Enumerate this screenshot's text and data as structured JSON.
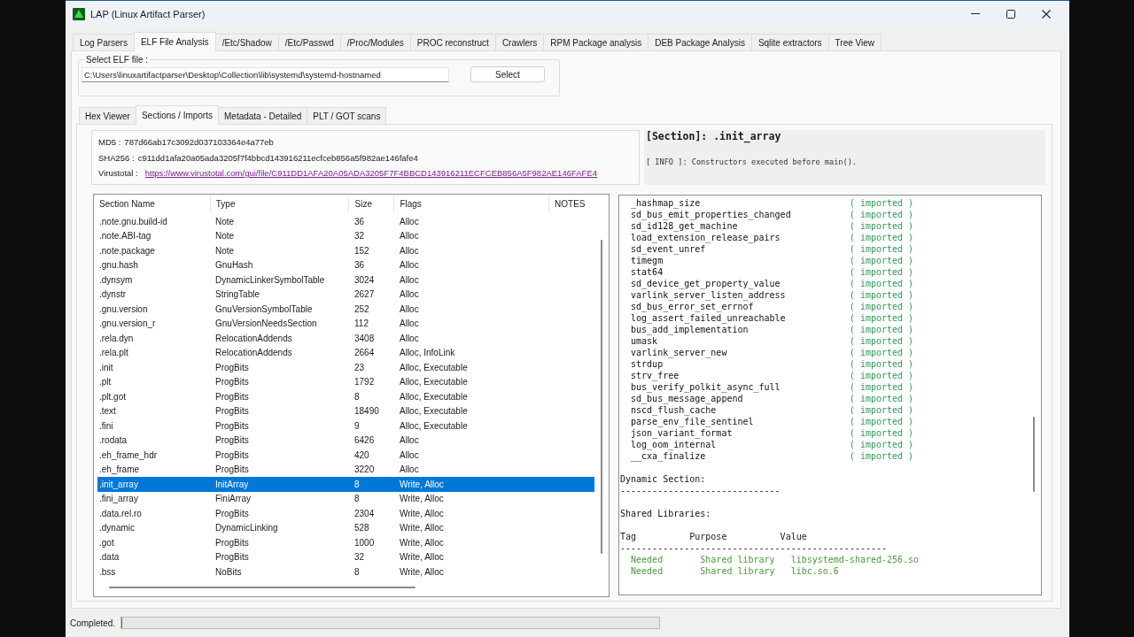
{
  "window": {
    "title": "LAP (Linux Artifact Parser)"
  },
  "tabs": [
    {
      "label": "Log Parsers",
      "selected": false
    },
    {
      "label": "ELF File Analysis",
      "selected": true
    },
    {
      "label": "/Etc/Shadow",
      "selected": false
    },
    {
      "label": "/Etc/Passwd",
      "selected": false
    },
    {
      "label": "/Proc/Modules",
      "selected": false
    },
    {
      "label": "PROC reconstruct",
      "selected": false
    },
    {
      "label": "Crawlers",
      "selected": false
    },
    {
      "label": "RPM Package analysis",
      "selected": false
    },
    {
      "label": "DEB Package Analysis",
      "selected": false
    },
    {
      "label": "Sqlite extractors",
      "selected": false
    },
    {
      "label": "Tree View",
      "selected": false
    }
  ],
  "elf_file": {
    "label": "Select ELF file :",
    "value": "C:\\Users\\linuxartifactparser\\Desktop\\Collection\\lib\\systemd\\systemd-hostnamed",
    "button": "Select"
  },
  "sub_tabs": [
    {
      "label": "Hex Viewer",
      "selected": false
    },
    {
      "label": "Sections / Imports",
      "selected": true
    },
    {
      "label": "Metadata - Detailed",
      "selected": false
    },
    {
      "label": "PLT / GOT scans",
      "selected": false
    }
  ],
  "hashes": [
    {
      "kind": "text",
      "label": "MD5 :",
      "value": "787d66ab17c3092d037103364e4a77eb"
    },
    {
      "kind": "text",
      "label": "SHA256 :",
      "value": "c911dd1afa20a05ada3205f7f4bbcd143916211ecfceb856a5f982ae146fafe4"
    },
    {
      "kind": "link",
      "label": "Virustotal :",
      "value": "https://www.virustotal.com/gui/file/C911DD1AFA20A05ADA3205F7F4BBCD143916211ECFCEB856A5F982AE146FAFE4"
    }
  ],
  "section_info": {
    "title": "[Section]: .init_array",
    "info": "[ INFO ]: Constructors executed before main()."
  },
  "sections_table": {
    "columns": [
      "Section Name",
      "Type",
      "Size",
      "Flags",
      "NOTES"
    ],
    "rows": [
      {
        "cells": [
          ".note.gnu.build-id",
          "Note",
          "36",
          "Alloc"
        ],
        "selected": false
      },
      {
        "cells": [
          ".note.ABI-tag",
          "Note",
          "32",
          "Alloc"
        ],
        "selected": false
      },
      {
        "cells": [
          ".note.package",
          "Note",
          "152",
          "Alloc"
        ],
        "selected": false
      },
      {
        "cells": [
          ".gnu.hash",
          "GnuHash",
          "36",
          "Alloc"
        ],
        "selected": false
      },
      {
        "cells": [
          ".dynsym",
          "DynamicLinkerSymbolTable",
          "3024",
          "Alloc"
        ],
        "selected": false
      },
      {
        "cells": [
          ".dynstr",
          "StringTable",
          "2627",
          "Alloc"
        ],
        "selected": false
      },
      {
        "cells": [
          ".gnu.version",
          "GnuVersionSymbolTable",
          "252",
          "Alloc"
        ],
        "selected": false
      },
      {
        "cells": [
          ".gnu.version_r",
          "GnuVersionNeedsSection",
          "112",
          "Alloc"
        ],
        "selected": false
      },
      {
        "cells": [
          ".rela.dyn",
          "RelocationAddends",
          "3408",
          "Alloc"
        ],
        "selected": false
      },
      {
        "cells": [
          ".rela.plt",
          "RelocationAddends",
          "2664",
          "Alloc, InfoLink"
        ],
        "selected": false
      },
      {
        "cells": [
          ".init",
          "ProgBits",
          "23",
          "Alloc, Executable"
        ],
        "selected": false
      },
      {
        "cells": [
          ".plt",
          "ProgBits",
          "1792",
          "Alloc, Executable"
        ],
        "selected": false
      },
      {
        "cells": [
          ".plt.got",
          "ProgBits",
          "8",
          "Alloc, Executable"
        ],
        "selected": false
      },
      {
        "cells": [
          ".text",
          "ProgBits",
          "18490",
          "Alloc, Executable"
        ],
        "selected": false
      },
      {
        "cells": [
          ".fini",
          "ProgBits",
          "9",
          "Alloc, Executable"
        ],
        "selected": false
      },
      {
        "cells": [
          ".rodata",
          "ProgBits",
          "6426",
          "Alloc"
        ],
        "selected": false
      },
      {
        "cells": [
          ".eh_frame_hdr",
          "ProgBits",
          "420",
          "Alloc"
        ],
        "selected": false
      },
      {
        "cells": [
          ".eh_frame",
          "ProgBits",
          "3220",
          "Alloc"
        ],
        "selected": false
      },
      {
        "cells": [
          ".init_array",
          "InitArray",
          "8",
          "Write, Alloc"
        ],
        "selected": true
      },
      {
        "cells": [
          ".fini_array",
          "FiniArray",
          "8",
          "Write, Alloc"
        ],
        "selected": false
      },
      {
        "cells": [
          ".data.rel.ro",
          "ProgBits",
          "2304",
          "Write, Alloc"
        ],
        "selected": false
      },
      {
        "cells": [
          ".dynamic",
          "DynamicLinking",
          "528",
          "Write, Alloc"
        ],
        "selected": false
      },
      {
        "cells": [
          ".got",
          "ProgBits",
          "1000",
          "Write, Alloc"
        ],
        "selected": false
      },
      {
        "cells": [
          ".data",
          "ProgBits",
          "32",
          "Write, Alloc"
        ],
        "selected": false
      },
      {
        "cells": [
          ".bss",
          "NoBits",
          "8",
          "Write, Alloc"
        ],
        "selected": false
      }
    ]
  },
  "output": {
    "lines": [
      {
        "kind": "import",
        "name": "_hashmap_size",
        "status": "( imported )"
      },
      {
        "kind": "import",
        "name": "sd_bus_emit_properties_changed",
        "status": "( imported )"
      },
      {
        "kind": "import",
        "name": "sd_id128_get_machine",
        "status": "( imported )"
      },
      {
        "kind": "import",
        "name": "load_extension_release_pairs",
        "status": "( imported )"
      },
      {
        "kind": "import",
        "name": "sd_event_unref",
        "status": "( imported )"
      },
      {
        "kind": "import",
        "name": "timegm",
        "status": "( imported )"
      },
      {
        "kind": "import",
        "name": "stat64",
        "status": "( imported )"
      },
      {
        "kind": "import",
        "name": "sd_device_get_property_value",
        "status": "( imported )"
      },
      {
        "kind": "import",
        "name": "varlink_server_listen_address",
        "status": "( imported )"
      },
      {
        "kind": "import",
        "name": "sd_bus_error_set_errnof",
        "status": "( imported )"
      },
      {
        "kind": "import",
        "name": "log_assert_failed_unreachable",
        "status": "( imported )"
      },
      {
        "kind": "import",
        "name": "bus_add_implementation",
        "status": "( imported )"
      },
      {
        "kind": "import",
        "name": "umask",
        "status": "( imported )"
      },
      {
        "kind": "import",
        "name": "varlink_server_new",
        "status": "( imported )"
      },
      {
        "kind": "import",
        "name": "strdup",
        "status": "( imported )"
      },
      {
        "kind": "import",
        "name": "strv_free",
        "status": "( imported )"
      },
      {
        "kind": "import",
        "name": "bus_verify_polkit_async_full",
        "status": "( imported )"
      },
      {
        "kind": "import",
        "name": "sd_bus_message_append",
        "status": "( imported )"
      },
      {
        "kind": "import",
        "name": "nscd_flush_cache",
        "status": "( imported )"
      },
      {
        "kind": "import",
        "name": "parse_env_file_sentinel",
        "status": "( imported )"
      },
      {
        "kind": "import",
        "name": "json_variant_format",
        "status": "( imported )"
      },
      {
        "kind": "import",
        "name": "log_oom_internal",
        "status": "( imported )"
      },
      {
        "kind": "import",
        "name": "__cxa_finalize",
        "status": "( imported )"
      },
      {
        "kind": "blank"
      },
      {
        "kind": "heading",
        "text": "Dynamic Section:"
      },
      {
        "kind": "rule",
        "text": "------------------------------"
      },
      {
        "kind": "blank"
      },
      {
        "kind": "heading",
        "text": "Shared Libraries:"
      },
      {
        "kind": "blank"
      },
      {
        "kind": "columns",
        "cells": [
          "Tag",
          "Purpose",
          "Value"
        ]
      },
      {
        "kind": "rule",
        "text": "--------------------------------------------------"
      },
      {
        "kind": "row",
        "cells": [
          "Needed",
          "Shared library",
          "libsystemd-shared-256.so"
        ]
      },
      {
        "kind": "row",
        "cells": [
          "Needed",
          "Shared library",
          "libc.so.6"
        ]
      }
    ]
  },
  "status_bar": {
    "text": "Completed.",
    "progress": {
      "level": 0
    }
  }
}
